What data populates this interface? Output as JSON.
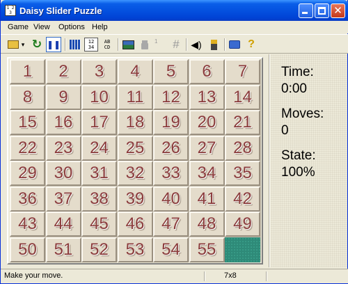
{
  "window": {
    "title": "Daisy Slider Puzzle",
    "app_icon_text": "1 2 3"
  },
  "titlebar_buttons": [
    "minimize",
    "maximize",
    "close"
  ],
  "menu": [
    "Game",
    "View",
    "Options",
    "Help"
  ],
  "toolbar": {
    "tools": [
      {
        "name": "open-icon",
        "glyph": "📂"
      },
      {
        "name": "dropdown-icon",
        "glyph": "▾"
      },
      {
        "name": "restart-icon",
        "glyph": "↻"
      },
      {
        "name": "pause-icon",
        "glyph": "❚❚"
      },
      {
        "name": "scramble-icon",
        "glyph": "▦"
      },
      {
        "name": "numbers-mode-icon",
        "glyph": "12\n34"
      },
      {
        "name": "letters-mode-icon",
        "glyph": "AB\nCD"
      },
      {
        "name": "picture-icon",
        "glyph": "▭"
      },
      {
        "name": "lock-icon",
        "glyph": "🔒"
      },
      {
        "name": "grid-icon",
        "glyph": "#"
      },
      {
        "name": "sound-icon",
        "glyph": "🔈"
      },
      {
        "name": "flashlight-icon",
        "glyph": "🔦"
      },
      {
        "name": "book-icon",
        "glyph": "📖"
      },
      {
        "name": "help-icon",
        "glyph": "?"
      }
    ],
    "superscript": "1"
  },
  "board": {
    "columns": 7,
    "rows": 8,
    "tiles": [
      "1",
      "2",
      "3",
      "4",
      "5",
      "6",
      "7",
      "8",
      "9",
      "10",
      "11",
      "12",
      "13",
      "14",
      "15",
      "16",
      "17",
      "18",
      "19",
      "20",
      "21",
      "22",
      "23",
      "24",
      "25",
      "26",
      "27",
      "28",
      "29",
      "30",
      "31",
      "32",
      "33",
      "34",
      "35",
      "36",
      "37",
      "38",
      "39",
      "40",
      "41",
      "42",
      "43",
      "44",
      "45",
      "46",
      "47",
      "48",
      "49",
      "50",
      "51",
      "52",
      "53",
      "54",
      "55",
      ""
    ]
  },
  "stats": {
    "time_label": "Time:",
    "time_value": "0:00",
    "moves_label": "Moves:",
    "moves_value": "0",
    "state_label": "State:",
    "state_value": "100%"
  },
  "status": {
    "message": "Make your move.",
    "board_size": "7x8"
  },
  "colors": {
    "tile_text": "#8b3c3c",
    "empty_slot": "#2e8a78",
    "titlebar": "#0451e0"
  }
}
